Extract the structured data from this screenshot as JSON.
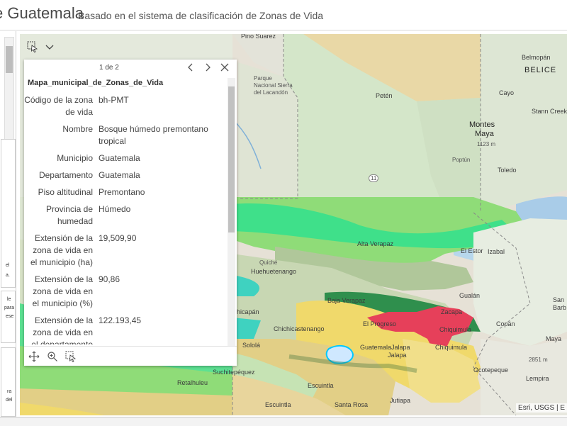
{
  "header": {
    "title": "e Guatemala",
    "subtitle": "Basado en el sistema de clasificación de Zonas de Vida"
  },
  "left_panel": {
    "box2_lines": [
      "el",
      "a."
    ],
    "box3_lines": [
      "le",
      "para",
      "ese"
    ],
    "box4_lines": [
      "ra",
      "del"
    ]
  },
  "map": {
    "labels": {
      "pino_suarez": "Pino Suarez",
      "belmopan": "Belmopán",
      "belice": "BELICE",
      "parque": "Parque",
      "nacional": "Nacional Sierra",
      "lacandon": "del Lacandón",
      "peten": "Petén",
      "cayo": "Cayo",
      "stann_creek": "Stann Creek",
      "montes": "Montes",
      "maya": "Maya",
      "elev1": "1123 m",
      "poptun": "Poptún",
      "toledo": "Toledo",
      "road": "11",
      "alta_verapaz": "Alta Verapaz",
      "el_estor": "El Estor",
      "izabal": "Izabal",
      "quiche": "Quiché",
      "huehuetenango": "Huehuetenango",
      "gualan": "Gualán",
      "baja_verapaz": "Baja Verapaz",
      "zacapa": "Zacapa",
      "chicapan": "hicapán",
      "el_progreso": "El Progreso",
      "chiquimula_city": "Chiquimula",
      "chichicastenango": "Chichicastenango",
      "copan": "Copán",
      "san_pedro": "San",
      "barba": "Barb",
      "guatemala": "Guatemala",
      "jalapa_dep": "Jalapa",
      "chiquimula_dep": "Chiquimula",
      "maya2": "Maya",
      "solola": "Sololá",
      "jalapa_city": "Jalapa",
      "elev2": "2851 m",
      "suchitepequez": "Suchitepéquez",
      "ocotepeque": "Ocotepeque",
      "retalhuleu": "Retalhuleu",
      "escuintla": "Escuintla",
      "lempira": "Lempira",
      "escuintla_dep": "Escuintla",
      "santa_rosa": "Santa Rosa",
      "jutiapa": "Jutiapa"
    },
    "attribution": "Esri, USGS | E"
  },
  "popup": {
    "pager": "1 de 2",
    "title": "Mapa_municipal_de_Zonas_de_Vida",
    "fields": [
      {
        "key": "Código de la zona de vida",
        "value": "bh-PMT"
      },
      {
        "key": "Nombre",
        "value": "Bosque húmedo premontano tropical"
      },
      {
        "key": "Municipio",
        "value": "Guatemala"
      },
      {
        "key": "Departamento",
        "value": "Guatemala"
      },
      {
        "key": "Piso altitudinal",
        "value": "Premontano"
      },
      {
        "key": "Provincia de humedad",
        "value": "Húmedo"
      },
      {
        "key": "Extensión de la zona de vida en el municipio (ha)",
        "value": "19,509,90"
      },
      {
        "key": "Extensión de la zona de vida en el municipio (%)",
        "value": "90,86"
      },
      {
        "key": "Extensión de la zona de vida en el departamento",
        "value": "122.193,45"
      }
    ]
  },
  "icons": {
    "select_tool": "select-cursor-icon",
    "dropdown": "chevron-down-icon",
    "prev": "chevron-left-icon",
    "next": "chevron-right-icon",
    "close": "close-icon",
    "pan": "pan-icon",
    "zoom": "zoom-to-icon",
    "select": "select-icon"
  },
  "colors": {
    "map_green": "#7fd46a",
    "map_bright_green": "#39e07c",
    "map_dark_green": "#2f8f4d",
    "map_yellow": "#f0d96b",
    "map_red": "#e6405a",
    "map_teal": "#3fd2c0",
    "water": "#a9cce8"
  }
}
